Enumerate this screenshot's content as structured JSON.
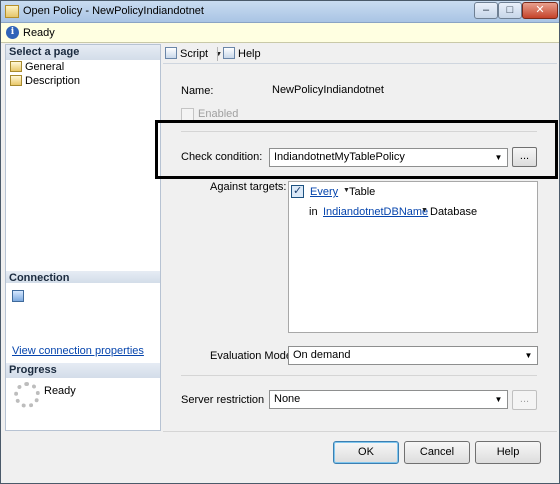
{
  "window": {
    "title": "Open Policy - NewPolicyIndiandotnet",
    "controls": {
      "minimize": "–",
      "maximize": "□",
      "close": "✕"
    }
  },
  "status": {
    "text": "Ready"
  },
  "sidebar": {
    "select_page_header": "Select a page",
    "pages": [
      {
        "label": "General"
      },
      {
        "label": "Description"
      }
    ],
    "connection_header": "Connection",
    "view_connection_link": "View connection properties",
    "progress_header": "Progress",
    "progress_status": "Ready"
  },
  "toolbar": {
    "script_label": "Script",
    "help_label": "Help"
  },
  "form": {
    "name_label": "Name:",
    "name_value": "NewPolicyIndiandotnet",
    "enabled_label": "Enabled",
    "enabled_checked": false,
    "check_condition_label": "Check condition:",
    "check_condition_value": "IndiandotnetMyTablePolicy",
    "ellipsis": "...",
    "against_targets_label": "Against targets:",
    "targets": {
      "row1": {
        "checked": true,
        "link": "Every",
        "type": "Table"
      },
      "row2": {
        "prefix": "in",
        "link": "IndiandotnetDBName",
        "type": "Database"
      }
    },
    "evaluation_mode_label": "Evaluation Mode:",
    "evaluation_mode_value": "On demand",
    "server_restriction_label": "Server restriction",
    "server_restriction_value": "None"
  },
  "buttons": {
    "ok": "OK",
    "cancel": "Cancel",
    "help": "Help"
  }
}
